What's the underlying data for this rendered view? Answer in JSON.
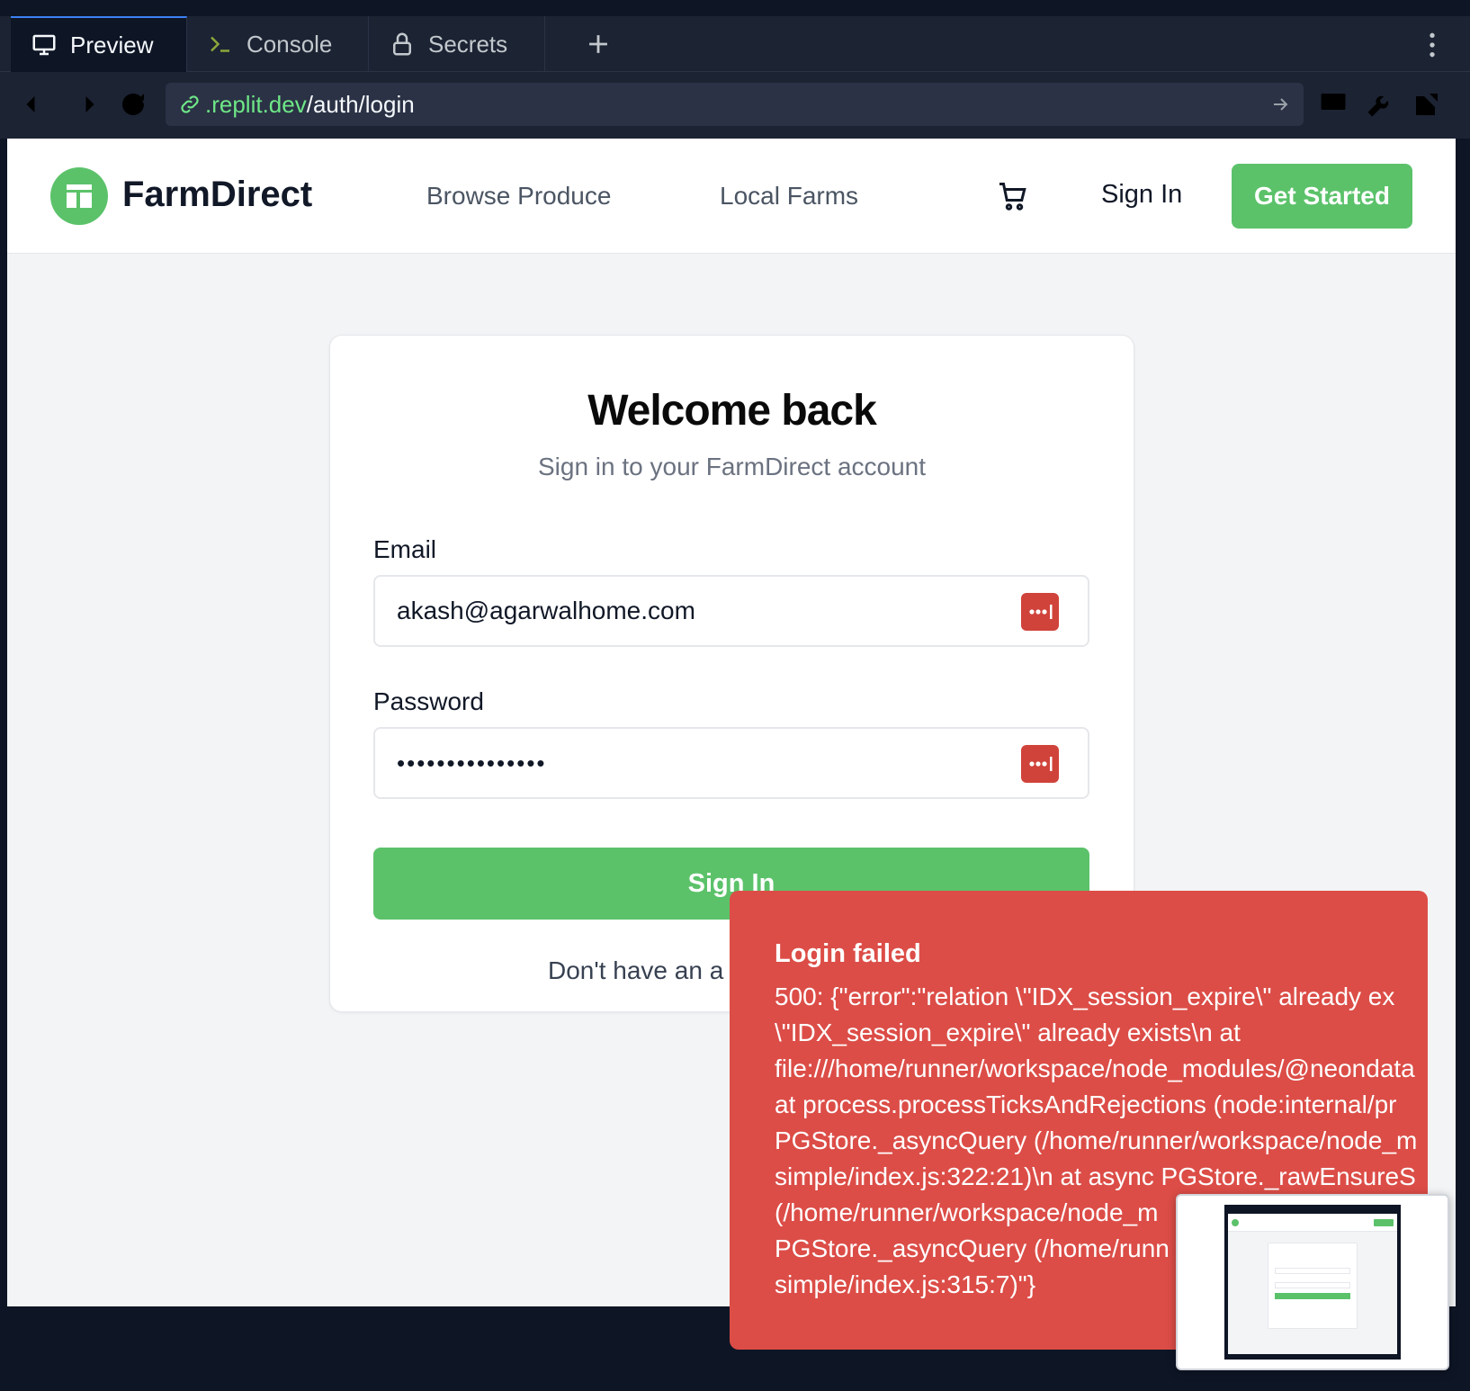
{
  "ide": {
    "tabs": [
      {
        "label": "Preview",
        "icon": "monitor-icon",
        "active": true
      },
      {
        "label": "Console",
        "icon": "terminal-icon",
        "active": false
      },
      {
        "label": "Secrets",
        "icon": "lock-icon",
        "active": false
      }
    ],
    "add_tab_icon": "plus-icon",
    "menu_icon": "more-vertical-icon"
  },
  "browser": {
    "url_host": ".replit.dev",
    "url_path": "/auth/login"
  },
  "site": {
    "brand": "FarmDirect",
    "nav": [
      "Browse Produce",
      "Local Farms"
    ],
    "sign_in": "Sign In",
    "get_started": "Get Started",
    "accent_color": "#5bc26a"
  },
  "login": {
    "title": "Welcome back",
    "subtitle": "Sign in to your FarmDirect account",
    "email_label": "Email",
    "email_value": "akash@agarwalhome.com",
    "password_label": "Password",
    "password_value": "•••••••••••••••",
    "submit": "Sign In",
    "footer": "Don't have an a"
  },
  "toast": {
    "title": "Login failed",
    "body": "500: {\"error\":\"relation \\\"IDX_session_expire\\\" already ex\n\\\"IDX_session_expire\\\" already exists\\n at\nfile:///home/runner/workspace/node_modules/@neondata\nat process.processTicksAndRejections (node:internal/pr\nPGStore._asyncQuery (/home/runner/workspace/node_m\nsimple/index.js:322:21)\\n at async PGStore._rawEnsureS\n(/home/runner/workspace/node_m\nPGStore._asyncQuery (/home/runn\nsimple/index.js:315:7)\"}",
    "color": "#dc4d47"
  }
}
